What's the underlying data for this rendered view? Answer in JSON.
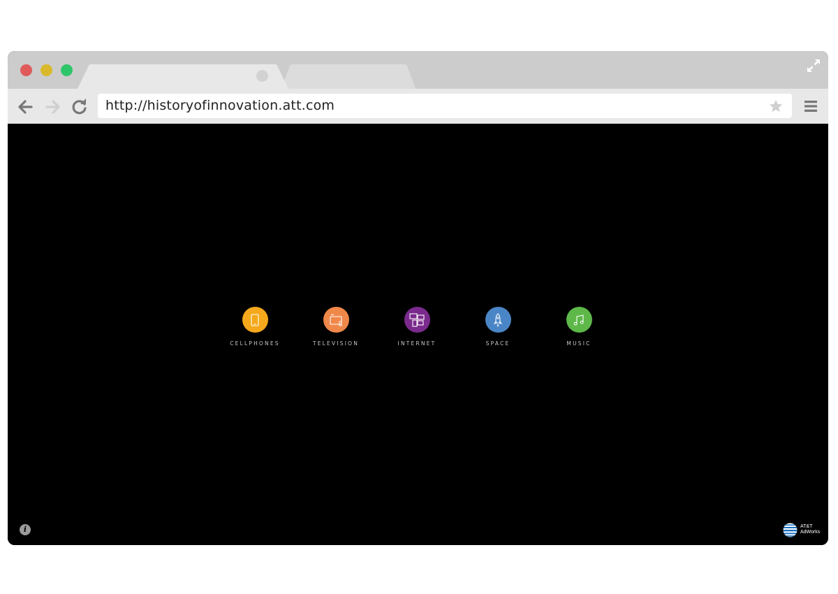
{
  "browser": {
    "url": "http://historyofinnovation.att.com"
  },
  "categories": [
    {
      "label": "CELLPHONES",
      "icon": "cellphone-icon",
      "color": "#f5a81c"
    },
    {
      "label": "TELEVISION",
      "icon": "television-icon",
      "color": "#f0884a"
    },
    {
      "label": "INTERNET",
      "icon": "internet-icon",
      "color": "#7a2a8c"
    },
    {
      "label": "SPACE",
      "icon": "rocket-icon",
      "color": "#4a86c6"
    },
    {
      "label": "MUSIC",
      "icon": "music-note-icon",
      "color": "#5db849"
    }
  ],
  "footer": {
    "logo_line1": "AT&T",
    "logo_line2": "AdWorks"
  }
}
